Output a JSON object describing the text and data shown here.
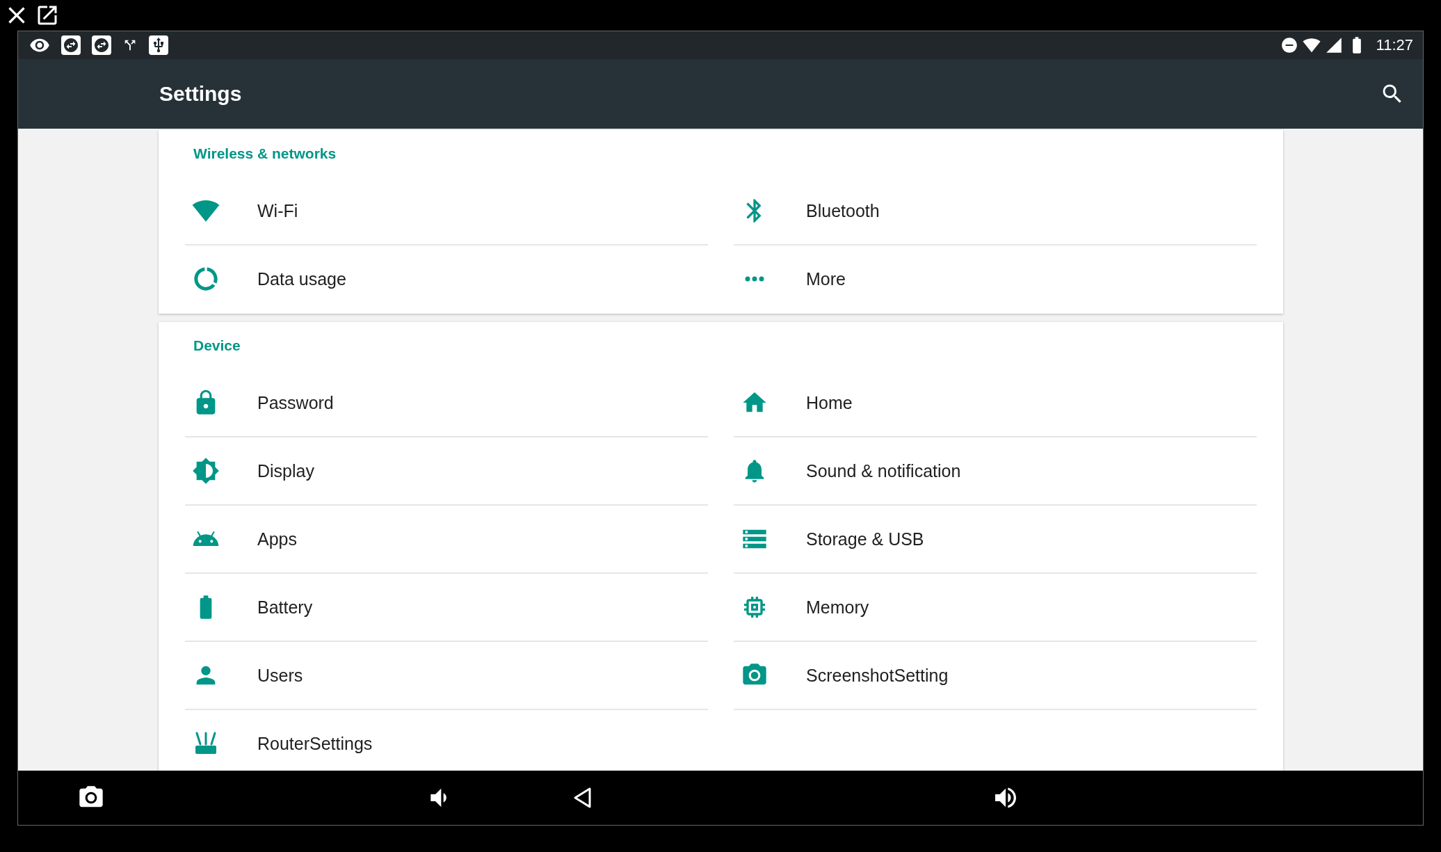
{
  "status_bar": {
    "time": "11:27"
  },
  "toolbar": {
    "title": "Settings"
  },
  "sections": [
    {
      "title": "Wireless & networks",
      "items": [
        {
          "label": "Wi-Fi"
        },
        {
          "label": "Bluetooth"
        },
        {
          "label": "Data usage"
        },
        {
          "label": "More"
        }
      ]
    },
    {
      "title": "Device",
      "items": [
        {
          "label": "Password"
        },
        {
          "label": "Home"
        },
        {
          "label": "Display"
        },
        {
          "label": "Sound & notification"
        },
        {
          "label": "Apps"
        },
        {
          "label": "Storage & USB"
        },
        {
          "label": "Battery"
        },
        {
          "label": "Memory"
        },
        {
          "label": "Users"
        },
        {
          "label": "ScreenshotSetting"
        },
        {
          "label": "RouterSettings"
        }
      ]
    }
  ]
}
